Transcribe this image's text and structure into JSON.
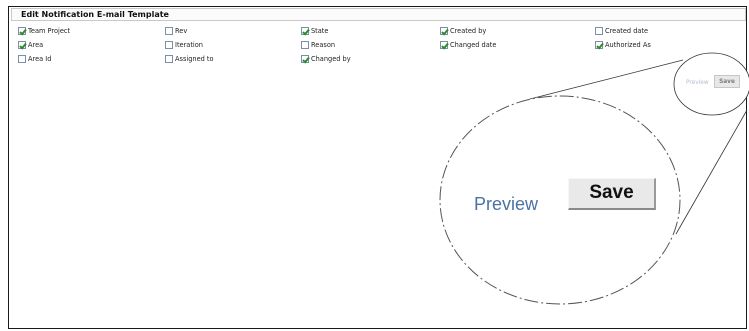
{
  "panel": {
    "title": "Edit Notification E-mail Template",
    "fields": [
      {
        "label": "Team Project",
        "checked": true
      },
      {
        "label": "Rev",
        "checked": false
      },
      {
        "label": "State",
        "checked": true
      },
      {
        "label": "Created by",
        "checked": true
      },
      {
        "label": "Created date",
        "checked": false
      },
      {
        "label": "Area",
        "checked": true
      },
      {
        "label": "Iteration",
        "checked": false
      },
      {
        "label": "Reason",
        "checked": false
      },
      {
        "label": "Changed date",
        "checked": true
      },
      {
        "label": "Authorized As",
        "checked": true
      },
      {
        "label": "Area Id",
        "checked": false
      },
      {
        "label": "Assigned to",
        "checked": false
      },
      {
        "label": "Changed by",
        "checked": true
      }
    ]
  },
  "actions": {
    "preview_label": "Preview",
    "save_label": "Save"
  }
}
